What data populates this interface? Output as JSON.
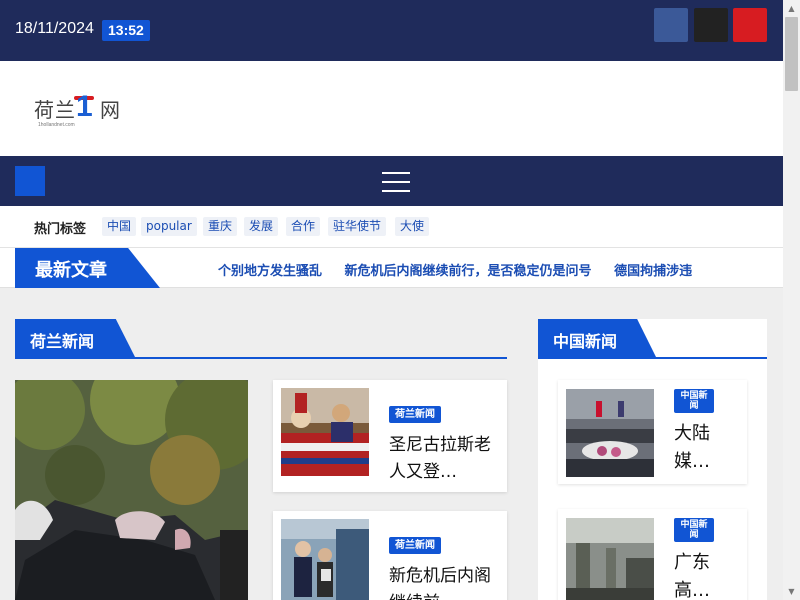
{
  "topbar": {
    "date": "18/11/2024",
    "time": "13:52",
    "social": [
      {
        "icon": "facebook-icon",
        "glyph": "",
        "color": "#3b5998"
      },
      {
        "icon": "x-twitter-icon",
        "glyph": "",
        "color": "#222222"
      },
      {
        "icon": "youtube-icon",
        "glyph": "",
        "color": "#d71c21"
      }
    ]
  },
  "logo": {
    "text": "荷兰",
    "number": "1",
    "suffix": "网",
    "sub": "1hollandnet.com"
  },
  "nav": {
    "home_glyph": "",
    "search_glyph": ""
  },
  "tags": {
    "icon_glyph": "",
    "title": "热门标签",
    "items": [
      "中国",
      "popular",
      "重庆",
      "发展",
      "合作",
      "驻华使节",
      "大使"
    ]
  },
  "ticker": {
    "label": "最新文章",
    "icon_glyph": "",
    "items": [
      "个别地方发生骚乱",
      "新危机后内阁继续前行，是否稳定仍是问号",
      "德国拘捕涉违"
    ]
  },
  "left_section": {
    "title": "荷兰新闻",
    "cards": [
      {
        "badge": "荷兰新闻",
        "title": "圣尼古拉斯老人又登…"
      },
      {
        "badge": "荷兰新闻",
        "title": "新危机后内阁继续前…"
      }
    ]
  },
  "right_section": {
    "title": "中国新闻",
    "cards": [
      {
        "badge": "中国新闻",
        "title": "大陆媒…"
      },
      {
        "badge": "中国新闻",
        "title": "广东高…"
      }
    ]
  },
  "scrollbar": {
    "up_glyph": "▲",
    "down_glyph": "▼"
  },
  "colors": {
    "navy": "#1f2b5b",
    "accent": "#1155d4"
  }
}
